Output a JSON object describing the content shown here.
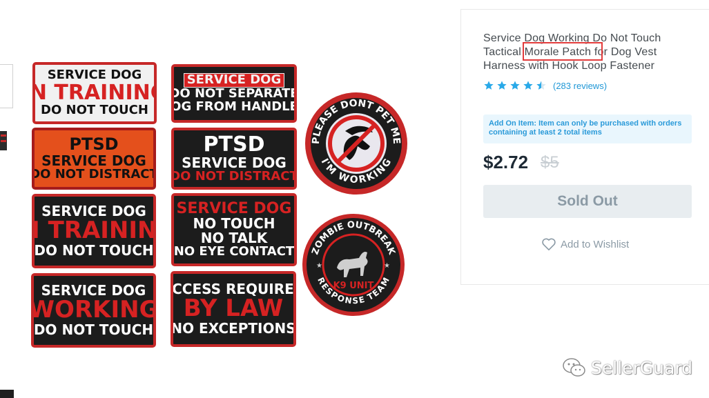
{
  "product": {
    "title": "Service Dog Working Do Not Touch Tactical Morale Patch for Dog Vest Harness with Hook Loop Fastener",
    "highlighted_phrase": "Morale Patch",
    "rating": 4.5,
    "reviews_label": "(283 reviews)",
    "addon_notice": "Add On Item: Item can only be purchased with orders containing at least 2 total items",
    "price": "$2.72",
    "original_price": "$5",
    "sold_out_label": "Sold Out",
    "wishlist_label": "Add to Wishlist",
    "colors": {
      "link": "#1f97d6",
      "price": "#1e2a35",
      "highlight_box": "#e23b3b",
      "patch_red": "#d62222"
    }
  },
  "image": {
    "patches": [
      {
        "id": "p1",
        "lines": [
          "SERVICE DOG",
          "IN TRAINING",
          "DO NOT TOUCH"
        ]
      },
      {
        "id": "p2",
        "lines": [
          "SERVICE DOG",
          "DO NOT SEPARATE",
          "DOG FROM HANDLER"
        ]
      },
      {
        "id": "p3",
        "lines": [
          "PTSD",
          "SERVICE DOG",
          "DO NOT DISTRACT"
        ]
      },
      {
        "id": "p4",
        "lines": [
          "PTSD",
          "SERVICE DOG",
          "DO NOT DISTRACT"
        ]
      },
      {
        "id": "p5",
        "lines": [
          "SERVICE DOG",
          "IN TRAINING",
          "DO NOT TOUCH"
        ]
      },
      {
        "id": "p6",
        "lines": [
          "SERVICE DOG",
          "NO TOUCH",
          "NO TALK",
          "NO EYE CONTACT"
        ]
      },
      {
        "id": "p7",
        "lines": [
          "SERVICE DOG",
          "WORKING",
          "DO NOT TOUCH"
        ]
      },
      {
        "id": "p8",
        "lines": [
          "ACCESS REQUIRED",
          "BY LAW",
          "NO EXCEPTIONS"
        ]
      }
    ],
    "round_patches": [
      {
        "id": "r1",
        "top_text": "PLEASE DONT PET ME",
        "bottom_text": "I'M WORKING"
      },
      {
        "id": "r2",
        "top_text": "ZOMBIE OUTBREAK",
        "center_text": "K9 UNIT",
        "bottom_text": "RESPONSE TEAM"
      }
    ]
  },
  "watermark": {
    "text": "SellerGuard",
    "icon": "wechat-icon"
  }
}
